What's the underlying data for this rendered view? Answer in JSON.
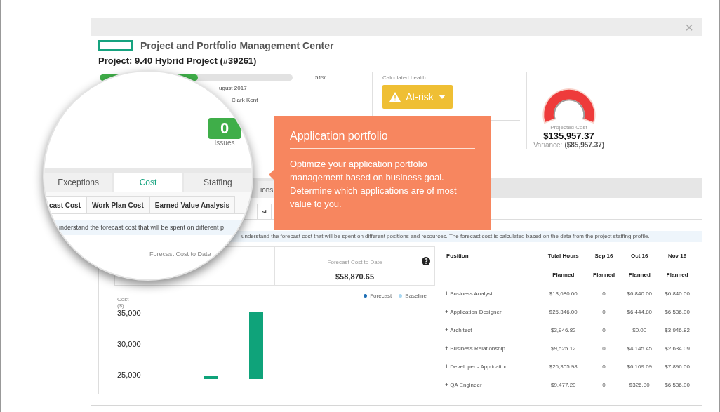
{
  "window": {
    "close": "×"
  },
  "app_title": "Project and Portfolio Management Center",
  "project_title": "Project: 9.40 Hybrid Project (#39261)",
  "summary": {
    "progress": {
      "level": 0.51,
      "reading": "51%"
    },
    "date": "ugust 2017",
    "owner": "Clark Kent",
    "health": {
      "label": "Calculated health",
      "status": "At-risk",
      "kind": "warning"
    },
    "projected": {
      "label": "Projected Cost",
      "value": "$135,957.37",
      "variance_label": "Variance:",
      "variance": "($85,957.37)"
    }
  },
  "tabs": [
    {
      "label": "ions",
      "selected": false
    }
  ],
  "subtabs": [
    {
      "label": "st",
      "selected": true
    }
  ],
  "info_banner": "understand the forecast cost that will be spent on different positions and resources. The forecast cost is calculated based on the data from the project staffing profile.",
  "kpis": [
    {
      "label": "Forecast Cost to Date",
      "value": "$58,870.65"
    }
  ],
  "chart": {
    "legend": [
      {
        "label": "Forecast",
        "color": "#1f6fb5"
      },
      {
        "label": "Baseline",
        "color": "#a9d8f2"
      }
    ],
    "ylabel": "Cost ($)",
    "yticks": [
      "35,000",
      "30,000",
      "25,000"
    ]
  },
  "table": {
    "columns": [
      "Position",
      "Total Hours",
      "Sep 16",
      "Oct 16",
      "Nov 16"
    ],
    "subheader": [
      "Planned",
      "Planned",
      "Planned",
      "Planned"
    ],
    "rows": [
      {
        "cells": [
          "Business Analyst",
          "$13,680.00",
          "0",
          "$6,840.00",
          "$6,840.00"
        ]
      },
      {
        "cells": [
          "Application Designer",
          "$25,346.00",
          "0",
          "$6,444.80",
          "$6,536.00"
        ]
      },
      {
        "cells": [
          "Architect",
          "$3,946.82",
          "0",
          "$0.00",
          "$3,946.82"
        ]
      },
      {
        "cells": [
          "Business Relationship...",
          "$9,525.12",
          "0",
          "$4,145.45",
          "$2,634.09"
        ]
      },
      {
        "cells": [
          "Developer - Application",
          "$26,305.98",
          "0",
          "$6,109.09",
          "$7,896.00"
        ]
      },
      {
        "cells": [
          "QA Engineer",
          "$9,477.20",
          "0",
          "$326.80",
          "$6,536.00"
        ]
      }
    ],
    "expander": "+"
  },
  "magnifier": {
    "issues": {
      "count": "0",
      "label": "Issues"
    },
    "tabs": [
      {
        "label": "Exceptions",
        "selected": false
      },
      {
        "label": "Cost",
        "selected": true
      },
      {
        "label": "Staffing",
        "selected": false
      }
    ],
    "subtabs": [
      {
        "label": "cast Cost",
        "selected": true
      },
      {
        "label": "Work Plan Cost",
        "selected": false
      },
      {
        "label": "Earned Value Analysis",
        "selected": false
      }
    ],
    "banner": "understand the forecast cost that will be spent on different p",
    "kpi_label": "Forecast Cost to Date"
  },
  "tooltip": {
    "title": "Application portfolio",
    "body": "Optimize your application portfolio management based on business goal. Determine which applications are of most value to you."
  }
}
